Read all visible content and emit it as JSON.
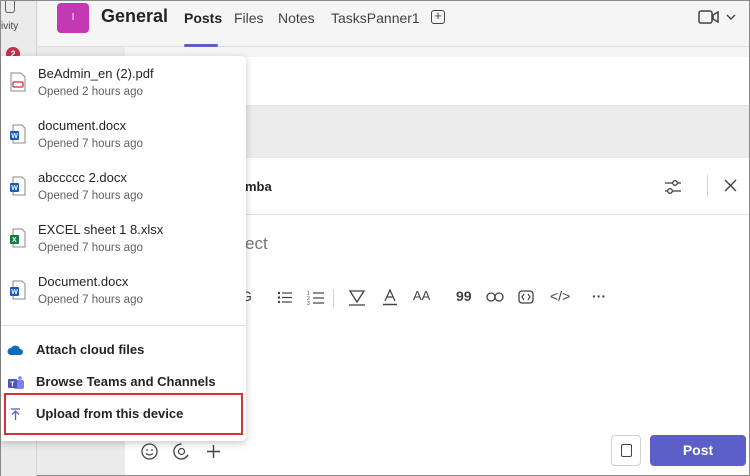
{
  "rail": {
    "activity_label": "ivity",
    "badge": "2"
  },
  "header": {
    "team_initial": "I",
    "channel_name": "General",
    "tabs": [
      {
        "label": "Posts",
        "active": true
      },
      {
        "label": "Files",
        "active": false
      },
      {
        "label": "Notes",
        "active": false
      },
      {
        "label": "TasksPanner1",
        "active": false
      }
    ],
    "add_tab_icon": "plus-box-icon",
    "meet_icon": "video-camera-icon"
  },
  "compose": {
    "name_partial": "mba",
    "subject_placeholder": "ect",
    "format_icons": [
      "G",
      "≔",
      "⒈",
      "▽",
      "A",
      "AA",
      "99",
      "⊂⊃",
      "⊡",
      "</>",
      "···"
    ],
    "post_label": "Post"
  },
  "menu": {
    "recent_files": [
      {
        "name": "BeAdmin_en (2).pdf",
        "opened": "Opened 2 hours ago",
        "type": "pdf"
      },
      {
        "name": "document.docx",
        "opened": "Opened 7 hours ago",
        "type": "word"
      },
      {
        "name": "abccccc 2.docx",
        "opened": "Opened 7 hours ago",
        "type": "word"
      },
      {
        "name": "EXCEL sheet 1 8.xlsx",
        "opened": "Opened 7 hours ago",
        "type": "excel"
      },
      {
        "name": "Document.docx",
        "opened": "Opened 7 hours ago",
        "type": "word"
      }
    ],
    "actions": [
      {
        "label": "Attach cloud files",
        "icon": "onedrive-cloud-icon"
      },
      {
        "label": "Browse Teams and Channels",
        "icon": "teams-icon"
      },
      {
        "label": "Upload from this device",
        "icon": "upload-icon"
      }
    ]
  },
  "colors": {
    "accent": "#5b5fc7",
    "team_avatar": "#c239b3",
    "highlight": "#d13438",
    "word": "#185abd",
    "excel": "#107c41",
    "pdf": "#c4314b"
  }
}
